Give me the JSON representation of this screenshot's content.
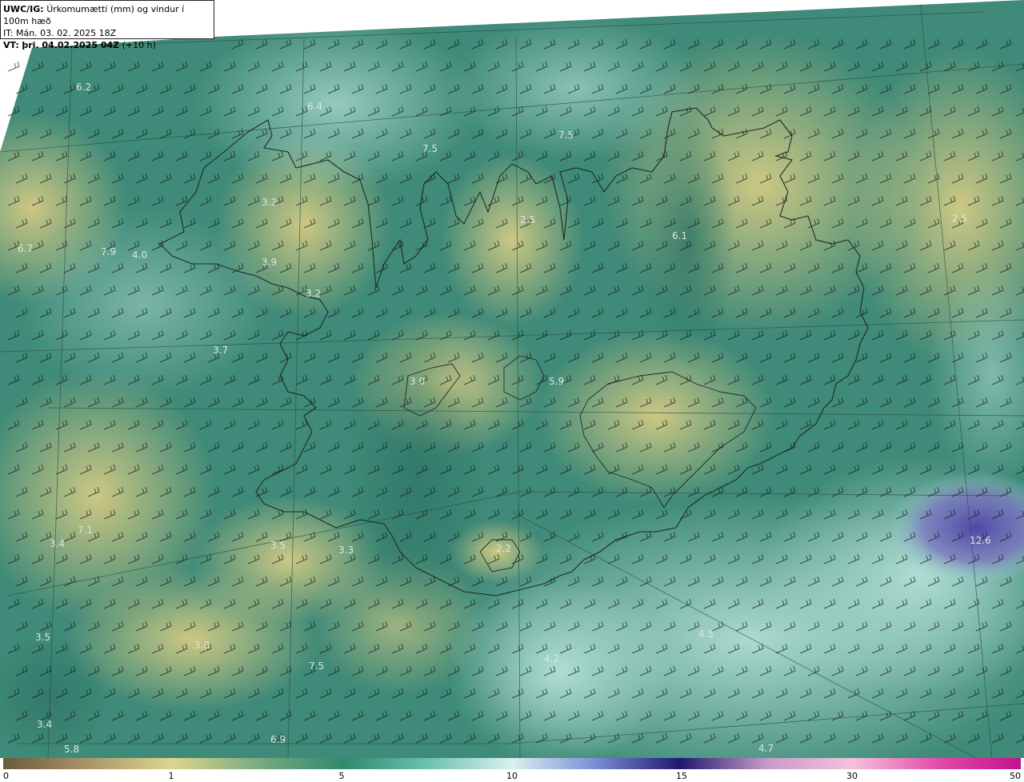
{
  "header": {
    "product": "UWC/IG:",
    "title": "Úrkomumætti (mm) og vindur í 100m hæð",
    "it_label": "IT:",
    "it_value": "Mán. 03. 02. 2025 18Z",
    "vt_label": "VT:",
    "vt_value": "þri. 04.02.2025 04Z",
    "vt_offset": "(+10 h)"
  },
  "colors": {
    "ocean_teal": "#3f8a78",
    "land_green": "#4e9474",
    "yellow_high": "#c9c27a",
    "light_cyan": "#a9d9cf",
    "purple_band": "#6a62b2"
  },
  "scale": {
    "ticks": [
      "0",
      "1",
      "5",
      "10",
      "15",
      "30",
      "50"
    ]
  },
  "value_labels": [
    {
      "text": "6.2"
    },
    {
      "text": "6.4"
    },
    {
      "text": "7.5"
    },
    {
      "text": "7.5"
    },
    {
      "text": "3.2"
    },
    {
      "text": "2.5"
    },
    {
      "text": "6.1"
    },
    {
      "text": "2.5"
    },
    {
      "text": "6.7"
    },
    {
      "text": "7.9"
    },
    {
      "text": "4.0"
    },
    {
      "text": "3.9"
    },
    {
      "text": "3.2"
    },
    {
      "text": "3.7"
    },
    {
      "text": "3.0"
    },
    {
      "text": "5.9"
    },
    {
      "text": "7.1"
    },
    {
      "text": "3.4"
    },
    {
      "text": "3.5"
    },
    {
      "text": "3.3"
    },
    {
      "text": "2.2"
    },
    {
      "text": "12.6"
    },
    {
      "text": "3.5"
    },
    {
      "text": "3.0"
    },
    {
      "text": "7.5"
    },
    {
      "text": "4.2"
    },
    {
      "text": "4.5"
    },
    {
      "text": "3.4"
    },
    {
      "text": "5.8"
    },
    {
      "text": "6.9"
    },
    {
      "text": "4.7"
    }
  ]
}
